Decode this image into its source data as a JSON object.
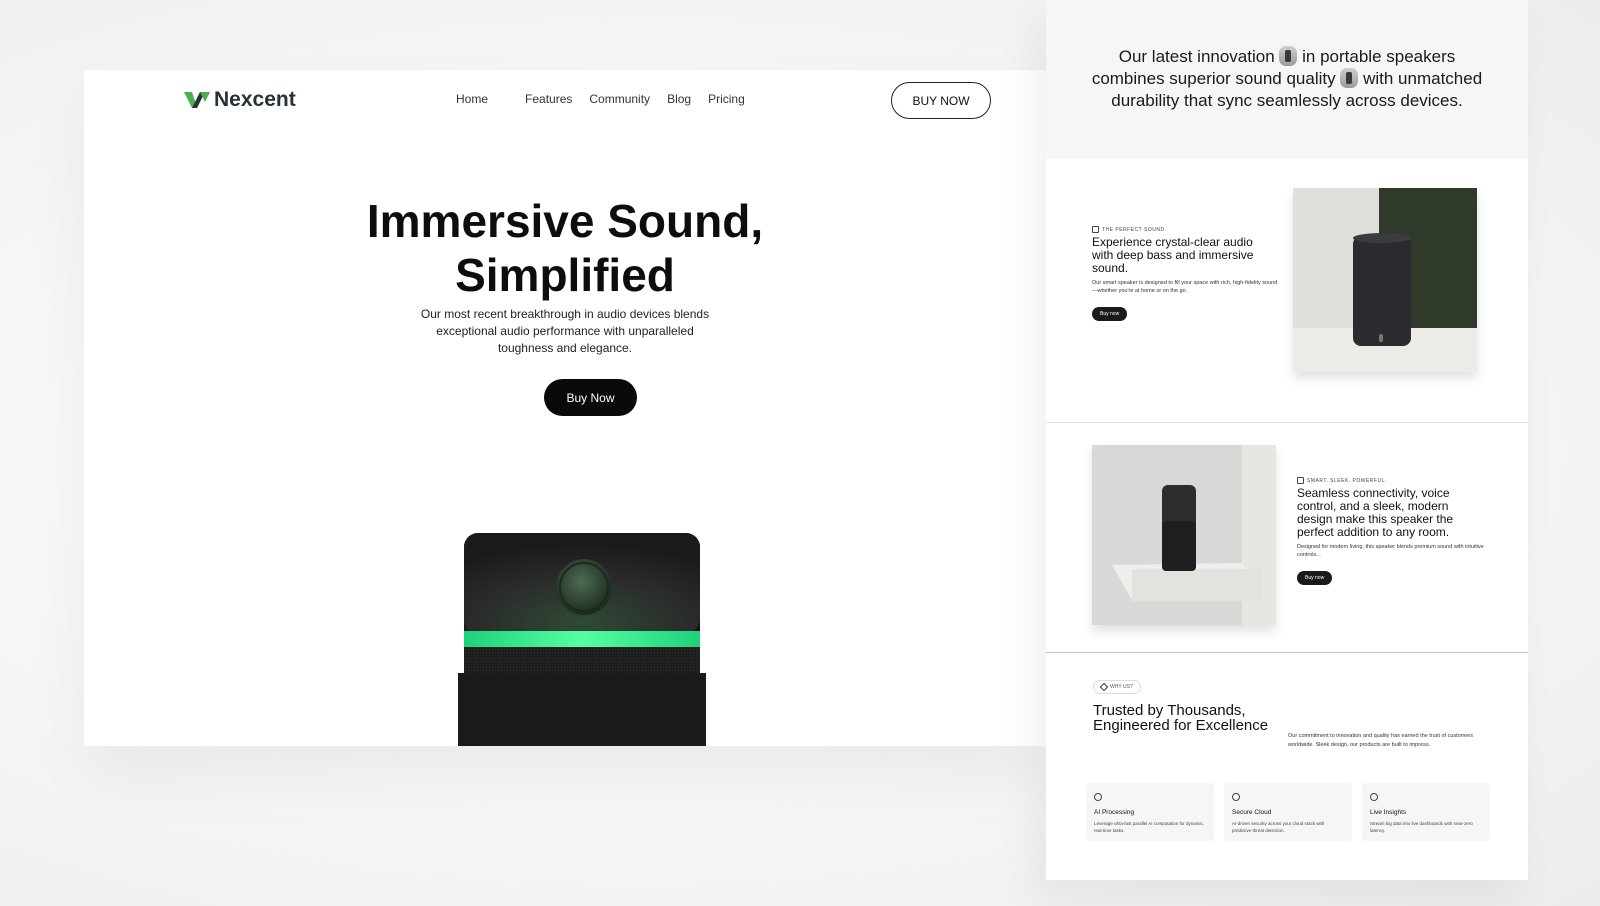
{
  "left": {
    "brand": "Nexcent",
    "nav": [
      "Home",
      "Features",
      "Community",
      "Blog",
      "Pricing"
    ],
    "nav_cta": "BUY NOW",
    "hero": {
      "title_line1": "Immersive Sound,",
      "title_line2": "Simplified",
      "desc_line1": "Our most recent breakthrough in audio devices blends",
      "desc_line2": "exceptional audio performance with unparalleled",
      "desc_line3": "toughness and elegance.",
      "cta": "Buy Now"
    }
  },
  "right": {
    "intro": {
      "part1": "Our latest innovation",
      "part2": "in portable speakers",
      "part3": "combines superior sound quality",
      "part4": "with unmatched",
      "part5": "durability that sync seamlessly across devices."
    },
    "section1": {
      "eyebrow": "THE PERFECT SOUND.",
      "title": "Experience crystal-clear audio with deep bass and immersive sound.",
      "desc": "Our smart speaker is designed to fill your space with rich, high-fidelity sound—whether you're at home or on the go.",
      "button": "Buy now"
    },
    "section2": {
      "eyebrow": "SMART. SLEEK. POWERFUL.",
      "title": "Seamless connectivity, voice control, and a sleek, modern design make this speaker the perfect addition to any room.",
      "desc": "Designed for modern living, this speaker blends premium sound with intuitive controls...",
      "button": "Buy now"
    },
    "why": {
      "badge": "WHY US?",
      "title": "Trusted by Thousands, Engineered for Excellence",
      "desc": "Our commitment to innovation and quality has earned the trust of customers worldwide. Sleek design, our products are built to impress.",
      "cards": [
        {
          "title": "AI Processing",
          "desc": "Leverage ultra-fast parallel AI computation for dynamic, real-time tasks."
        },
        {
          "title": "Secure Cloud",
          "desc": "AI-driven security across your cloud stack with predictive threat detection."
        },
        {
          "title": "Live Insights",
          "desc": "Stream big data into live dashboards with near-zero latency."
        }
      ]
    }
  },
  "colors": {
    "brand_green": "#4caf50",
    "glow_green": "#3dff9a",
    "dark": "#0a0a0a"
  },
  "icons": [
    "logo-icon",
    "pill-speaker-icon",
    "sound-wave-icon",
    "speaker-icon",
    "diamond-icon",
    "chip-icon",
    "shield-icon",
    "chart-icon"
  ]
}
